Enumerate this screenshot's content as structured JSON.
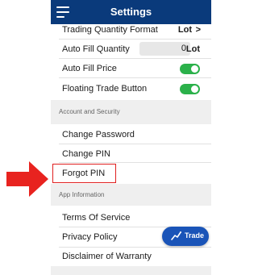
{
  "annotation": {
    "arrow_color": "#e8231f",
    "highlight_color": "#e02020"
  },
  "header": {
    "title": "Settings",
    "menu_icon": "hamburger-menu-icon",
    "background": "#0a3a7b"
  },
  "trading": {
    "quantity_format": {
      "label": "Trading Quantity Format",
      "value": "Lot",
      "chevron": ">"
    },
    "auto_fill_quantity": {
      "label": "Auto Fill Quantity",
      "value": "0",
      "unit": "Lot"
    },
    "auto_fill_price": {
      "label": "Auto Fill Price",
      "enabled": true
    },
    "floating_trade_button": {
      "label": "Floating Trade Button",
      "enabled": true
    }
  },
  "account_security": {
    "title": "Account and Security",
    "items": [
      {
        "label": "Change Password"
      },
      {
        "label": "Change PIN"
      },
      {
        "label": "Forgot PIN",
        "highlighted": true
      }
    ]
  },
  "app_information": {
    "title": "App Information",
    "items": [
      {
        "label": "Terms Of Service"
      },
      {
        "label": "Privacy Policy"
      },
      {
        "label": "Disclaimer of Warranty"
      }
    ]
  },
  "trade_button": {
    "label": "Trade",
    "icon": "chart-trend-icon",
    "color": "#1a54b8"
  },
  "toggle_color": "#2bb14a"
}
